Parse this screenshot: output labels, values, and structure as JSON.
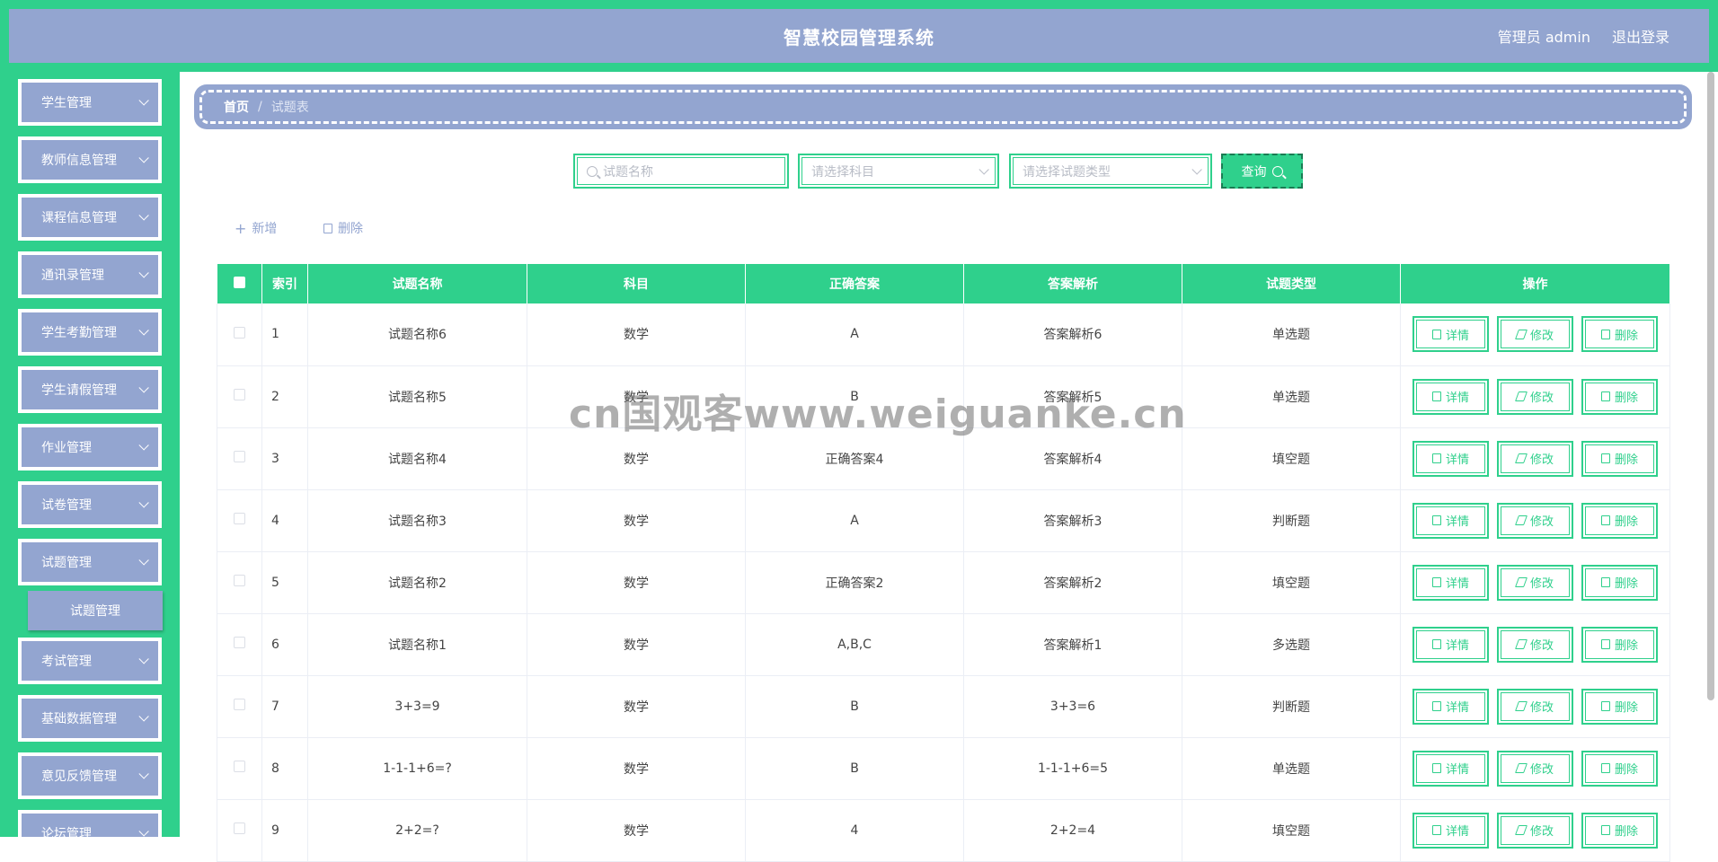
{
  "header": {
    "title": "智慧校园管理系统",
    "user": "管理员 admin",
    "logout": "退出登录"
  },
  "sidebar": {
    "items": [
      {
        "label": "学生管理"
      },
      {
        "label": "教师信息管理"
      },
      {
        "label": "课程信息管理"
      },
      {
        "label": "通讯录管理"
      },
      {
        "label": "学生考勤管理"
      },
      {
        "label": "学生请假管理"
      },
      {
        "label": "作业管理"
      },
      {
        "label": "试卷管理"
      },
      {
        "label": "试题管理"
      },
      {
        "label": "考试管理"
      },
      {
        "label": "基础数据管理"
      },
      {
        "label": "意见反馈管理"
      },
      {
        "label": "论坛管理"
      }
    ],
    "submenu": {
      "label": "试题管理"
    }
  },
  "breadcrumb": {
    "home": "首页",
    "separator": "/",
    "current": "试题表"
  },
  "search": {
    "name_placeholder": "试题名称",
    "subject_placeholder": "请选择科目",
    "type_placeholder": "请选择试题类型",
    "query_label": "查询"
  },
  "actions": {
    "add": "新增",
    "delete": "删除"
  },
  "table": {
    "headers": [
      "索引",
      "试题名称",
      "科目",
      "正确答案",
      "答案解析",
      "试题类型",
      "操作"
    ],
    "rows": [
      {
        "index": "1",
        "name": "试题名称6",
        "subject": "数学",
        "answer": "A",
        "analysis": "答案解析6",
        "type": "单选题"
      },
      {
        "index": "2",
        "name": "试题名称5",
        "subject": "数学",
        "answer": "B",
        "analysis": "答案解析5",
        "type": "单选题"
      },
      {
        "index": "3",
        "name": "试题名称4",
        "subject": "数学",
        "answer": "正确答案4",
        "analysis": "答案解析4",
        "type": "填空题"
      },
      {
        "index": "4",
        "name": "试题名称3",
        "subject": "数学",
        "answer": "A",
        "analysis": "答案解析3",
        "type": "判断题"
      },
      {
        "index": "5",
        "name": "试题名称2",
        "subject": "数学",
        "answer": "正确答案2",
        "analysis": "答案解析2",
        "type": "填空题"
      },
      {
        "index": "6",
        "name": "试题名称1",
        "subject": "数学",
        "answer": "A,B,C",
        "analysis": "答案解析1",
        "type": "多选题"
      },
      {
        "index": "7",
        "name": "3+3=9",
        "subject": "数学",
        "answer": "B",
        "analysis": "3+3=6",
        "type": "判断题"
      },
      {
        "index": "8",
        "name": "1-1-1+6=?",
        "subject": "数学",
        "answer": "B",
        "analysis": "1-1-1+6=5",
        "type": "单选题"
      },
      {
        "index": "9",
        "name": "2+2=?",
        "subject": "数学",
        "answer": "4",
        "analysis": "2+2=4",
        "type": "填空题"
      }
    ],
    "op_labels": {
      "detail": "详情",
      "edit": "修改",
      "delete": "删除"
    }
  },
  "watermark": "cn国观客www.weiguanke.cn",
  "colors": {
    "accent": "#2fd08c",
    "primary": "#93a5d0"
  }
}
